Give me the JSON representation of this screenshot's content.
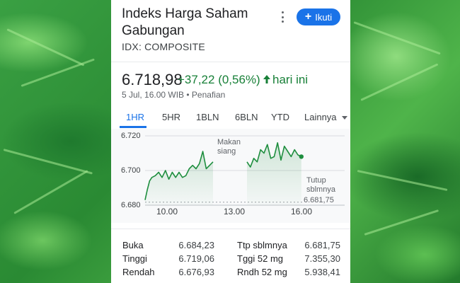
{
  "card": {
    "title": "Indeks Harga Saham Gabungan",
    "symbol": "IDX: COMPOSITE",
    "follow_label": "Ikuti",
    "price": "6.718,98",
    "change": "+37,22 (0,56%)",
    "change_period": "hari ini",
    "timestamp": "5 Jul, 16.00 WIB • Penafian"
  },
  "tabs": [
    "1HR",
    "5HR",
    "1BLN",
    "6BLN",
    "YTD",
    "Lainnya"
  ],
  "active_tab": "1HR",
  "chart_data": {
    "type": "line",
    "x_ticks": [
      "10.00",
      "13.00",
      "16.00"
    ],
    "y_ticks": [
      "6.720",
      "6.700",
      "6.680"
    ],
    "ylim": [
      6680,
      6720
    ],
    "annotations": {
      "lunch": "Makan siang",
      "prev_close_label": "Tutup sblmnya",
      "prev_close_value": "6.681,75"
    },
    "prev_close": 6681.75,
    "morning": {
      "x": [
        9.0,
        9.1,
        9.2,
        9.3,
        9.45,
        9.6,
        9.75,
        9.9,
        10.05,
        10.2,
        10.35,
        10.5,
        10.65,
        10.8,
        10.95,
        11.1,
        11.25,
        11.4,
        11.55,
        11.7,
        11.85,
        12.0
      ],
      "y": [
        6683,
        6689,
        6694,
        6696,
        6697,
        6699,
        6696,
        6700,
        6695,
        6699,
        6696,
        6699,
        6696,
        6697,
        6701,
        6703,
        6701,
        6704,
        6711,
        6701,
        6703,
        6705
      ]
    },
    "afternoon": {
      "x": [
        13.5,
        13.65,
        13.8,
        13.95,
        14.1,
        14.25,
        14.4,
        14.55,
        14.7,
        14.85,
        15.0,
        15.15,
        15.3,
        15.45,
        15.6,
        15.75,
        15.9
      ],
      "y": [
        6705,
        6702,
        6707,
        6705,
        6712,
        6710,
        6715,
        6707,
        6708,
        6716,
        6706,
        6714,
        6711,
        6708,
        6712,
        6709,
        6708
      ]
    }
  },
  "stats": {
    "open_label": "Buka",
    "open": "6.684,23",
    "high_label": "Tinggi",
    "high": "6.719,06",
    "low_label": "Rendah",
    "low": "6.676,93",
    "prev_close_label": "Ttp sblmnya",
    "prev_close": "6.681,75",
    "high52_label": "Tggi 52 mg",
    "high52": "7.355,30",
    "low52_label": "Rndh 52 mg",
    "low52": "5.938,41"
  },
  "colors": {
    "accent": "#1a73e8",
    "positive": "#188038",
    "line": "#1e8e3e"
  }
}
